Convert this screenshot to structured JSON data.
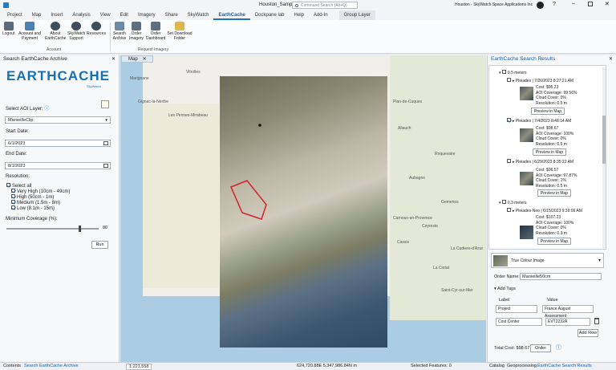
{
  "titlebar": {
    "project_name": "Houston_Samples",
    "search_placeholder": "Command Search (Alt+Q)",
    "user": "Houston - SkyWatch Space Applications Inc"
  },
  "tabs": [
    "Project",
    "Map",
    "Insert",
    "Analysis",
    "View",
    "Edit",
    "Imagery",
    "Share",
    "SkyWatch",
    "EarthCache",
    "Dockpane lab",
    "Help",
    "Add-In",
    "Group Layer"
  ],
  "active_tab": "EarthCache",
  "ribbon": {
    "buttons": [
      "Logout",
      "Account and Payment",
      "About EarthCache",
      "SkyWatch Support",
      "Resources",
      "Search Archive",
      "Order Imagery",
      "Order Dashboard",
      "Set Download Folder"
    ],
    "groups": [
      "Account",
      "Request Imagery"
    ]
  },
  "left_pane": {
    "title": "Search EarthCache Archive",
    "logo": "EARTHCACHE",
    "logo_sub": "SkyWatch",
    "aoi_label": "Select AOI Layer:",
    "aoi_value": "MarseilleClip",
    "start_label": "Start Date:",
    "start_value": "6/1/2023",
    "end_label": "End Date:",
    "end_value": "8/1/2023",
    "resolution_label": "Resolution:",
    "select_all": "Select all",
    "resolutions": [
      "Very High (10cm - 49cm)",
      "High (50cm - 1m)",
      "Medium (1.5m - 8m)",
      "Low (8.1m - 15m)"
    ],
    "coverage_label": "Minimum Coverage (%):",
    "coverage_value": "80",
    "run_button": "Run"
  },
  "map": {
    "tab": "Map",
    "labels": [
      "Marignane",
      "Vitrolles",
      "Gignac-la-Nerthe",
      "Les Pennes-Mirabeau",
      "Plan-de-Cuques",
      "Allauch",
      "Aubagne",
      "Gemenos",
      "Roquevaire",
      "Cassis",
      "La Ciotat",
      "Saint-Cyr-sur-Mer",
      "La Cadiere-d'Azur",
      "Ceyreste",
      "Carnoux-en-Provence"
    ]
  },
  "right_pane": {
    "title": "EarthCache Search Results",
    "group1": "0.5 meters",
    "group2": "0.3 meters",
    "results": [
      {
        "title": "Pleiades | 7/26/2023 8:27:21 AM",
        "cost": "Cost: $95.23",
        "coverage": "AOI Coverage: 99.56%",
        "cloud": "Cloud Cover: 0%",
        "res": "Resolution: 0.5 m",
        "btn": "Preview in Map"
      },
      {
        "title": "Pleiades | 7/4/2023 8:48:14 AM",
        "cost": "Cost: $98.67",
        "coverage": "AOI Coverage: 100%",
        "cloud": "Cloud Cover: 0%",
        "res": "Resolution: 0.5 m",
        "btn": "Preview in Map"
      },
      {
        "title": "Pleiades | 6/29/2023 8:35:22 AM",
        "cost": "Cost: $96.57",
        "coverage": "AOI Coverage: 97.87%",
        "cloud": "Cloud Cover: 1%",
        "res": "Resolution: 0.5 m",
        "btn": "Preview in Map"
      },
      {
        "title": "Pleiades-Neo | 6/15/2023 9:39:06 AM",
        "cost": "Cost: $107.23",
        "coverage": "AOI Coverage: 100%",
        "cloud": "Cloud Cover: 0%",
        "res": "Resolution: 0.3 m",
        "btn": "Preview in Map"
      }
    ],
    "product": "True Colour Image",
    "order_name_label": "Order Name:",
    "order_name_value": "Marseille50cm",
    "add_tags": "Add Tags",
    "label_header": "Label",
    "value_header": "Value",
    "tags": [
      {
        "label": "Project",
        "value": "France August Assessment"
      },
      {
        "label": "Cost Center",
        "value": "EVT2232A"
      }
    ],
    "add_row": "Add Row",
    "total_cost": "Total Cost: $98.67",
    "order_button": "Order"
  },
  "status": {
    "left_tabs": [
      "Contents",
      "Search EarthCache Archive"
    ],
    "scale": "1:221,558",
    "coords": "624,720.88E 5,347,986.84N m",
    "selected": "Selected Features: 0",
    "right_tabs": [
      "Catalog",
      "Geoprocessing",
      "EarthCache Search Results"
    ]
  }
}
